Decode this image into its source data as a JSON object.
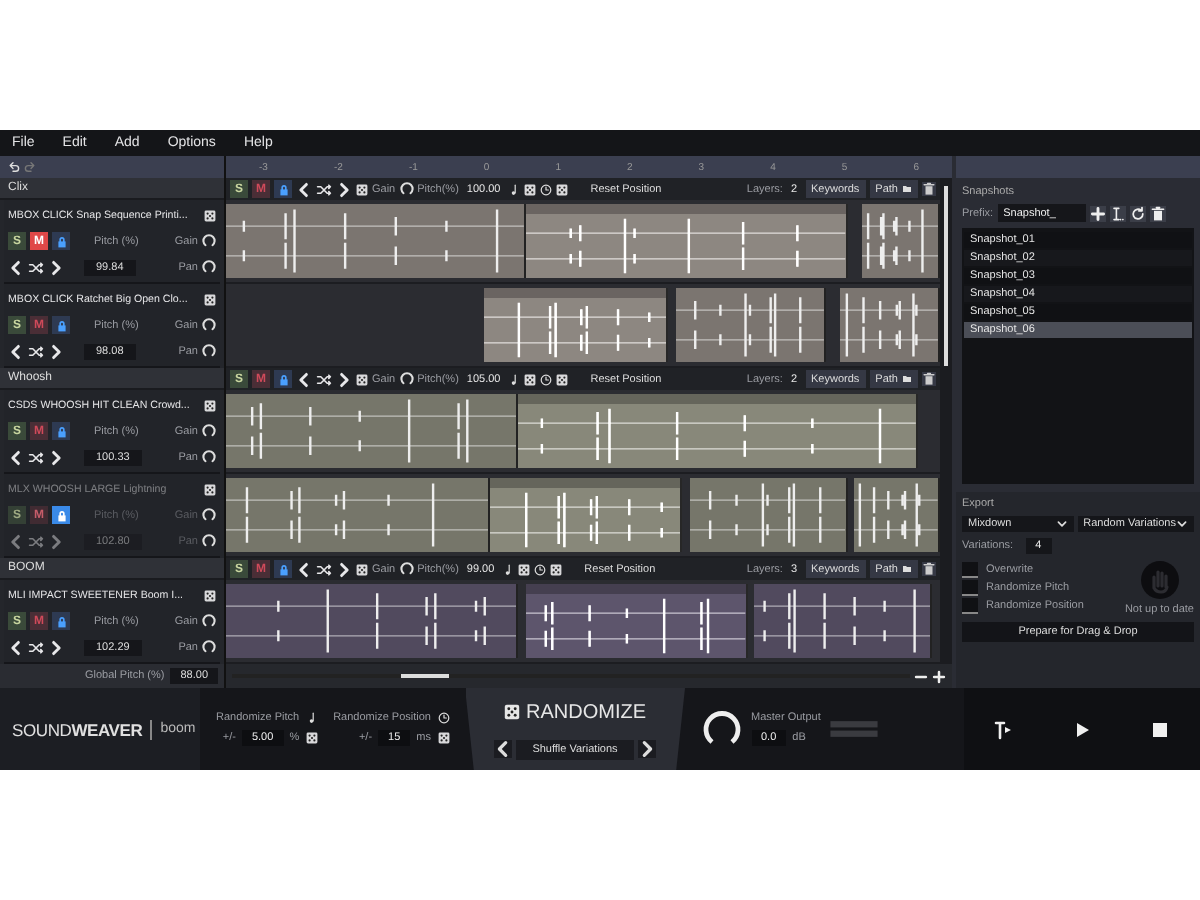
{
  "menu": [
    "File",
    "Edit",
    "Add",
    "Options",
    "Help"
  ],
  "ruler": [
    "-3",
    "-2",
    "-1",
    "0",
    "1",
    "2",
    "3",
    "4",
    "5",
    "6"
  ],
  "groups": [
    {
      "name": "Clix",
      "color": "#7b7570",
      "solo": "S",
      "mute": "M",
      "gain_label": "Gain",
      "pitch_label": "Pitch(%)",
      "pitch": "100.00",
      "reset": "Reset Position",
      "layers_label": "Layers:",
      "layers": "2",
      "keywords": "Keywords",
      "path": "Path",
      "sounds": [
        {
          "name": "MBOX CLICK Snap Sequence Printi...",
          "solo": "S",
          "mute": "M",
          "muted": true,
          "locked": false,
          "disabled": false,
          "pitch_label": "Pitch (%)",
          "pitch": "99.84",
          "gain_label": "Gain",
          "pan_label": "Pan"
        },
        {
          "name": "MBOX CLICK Ratchet Big Open Clo...",
          "solo": "S",
          "mute": "M",
          "muted": false,
          "locked": false,
          "disabled": false,
          "pitch_label": "Pitch (%)",
          "pitch": "98.08",
          "gain_label": "Gain",
          "pan_label": "Pan"
        }
      ]
    },
    {
      "name": "Whoosh",
      "color": "#76766a",
      "solo": "S",
      "mute": "M",
      "gain_label": "Gain",
      "pitch_label": "Pitch(%)",
      "pitch": "105.00",
      "reset": "Reset Position",
      "layers_label": "Layers:",
      "layers": "2",
      "keywords": "Keywords",
      "path": "Path",
      "sounds": [
        {
          "name": "CSDS WHOOSH HIT CLEAN Crowd...",
          "solo": "S",
          "mute": "M",
          "muted": false,
          "locked": false,
          "disabled": false,
          "pitch_label": "Pitch (%)",
          "pitch": "100.33",
          "gain_label": "Gain",
          "pan_label": "Pan"
        },
        {
          "name": "MLX WHOOSH LARGE Lightning",
          "solo": "S",
          "mute": "M",
          "muted": false,
          "locked": true,
          "disabled": true,
          "pitch_label": "Pitch (%)",
          "pitch": "102.80",
          "gain_label": "Gain",
          "pan_label": "Pan"
        }
      ]
    },
    {
      "name": "BOOM",
      "color": "#514a5e",
      "solo": "S",
      "mute": "M",
      "gain_label": "Gain",
      "pitch_label": "Pitch(%)",
      "pitch": "99.00",
      "reset": "Reset Position",
      "layers_label": "Layers:",
      "layers": "3",
      "keywords": "Keywords",
      "path": "Path",
      "sounds": [
        {
          "name": "MLI IMPACT SWEETENER Boom I...",
          "solo": "S",
          "mute": "M",
          "muted": false,
          "locked": false,
          "disabled": false,
          "pitch_label": "Pitch (%)",
          "pitch": "102.29",
          "gain_label": "Gain",
          "pan_label": "Pan"
        }
      ]
    }
  ],
  "global_pitch": {
    "label": "Global Pitch (%)",
    "value": "88.00"
  },
  "snapshots": {
    "title": "Snapshots",
    "prefix_label": "Prefix:",
    "prefix": "Snapshot_",
    "items": [
      {
        "label": "Snapshot_01",
        "selected": false
      },
      {
        "label": "Snapshot_02",
        "selected": false
      },
      {
        "label": "Snapshot_03",
        "selected": false
      },
      {
        "label": "Snapshot_04",
        "selected": false
      },
      {
        "label": "Snapshot_05",
        "selected": false
      },
      {
        "label": "Snapshot_06",
        "selected": true
      }
    ]
  },
  "export": {
    "title": "Export",
    "format": "Mixdown",
    "mode": "Random Variations",
    "variations_label": "Variations:",
    "variations": "4",
    "options": [
      {
        "label": "Overwrite",
        "checked": false
      },
      {
        "label": "Randomize Pitch",
        "checked": false
      },
      {
        "label": "Randomize Position",
        "checked": false
      }
    ],
    "status": "Not up to date",
    "button": "Prepare for Drag & Drop"
  },
  "logo": {
    "product": "SOUND**WEAVER**",
    "brand": "boom"
  },
  "randomize_pitch": {
    "label": "Randomize Pitch",
    "prefix": "+/-",
    "value": "5.00",
    "unit": "%"
  },
  "randomize_position": {
    "label": "Randomize Position",
    "prefix": "+/-",
    "value": "15",
    "unit": "ms"
  },
  "randomize": {
    "label": "RANDOMIZE",
    "mode": "Shuffle Variations"
  },
  "master": {
    "label": "Master Output",
    "value": "0.0",
    "unit": "dB"
  }
}
